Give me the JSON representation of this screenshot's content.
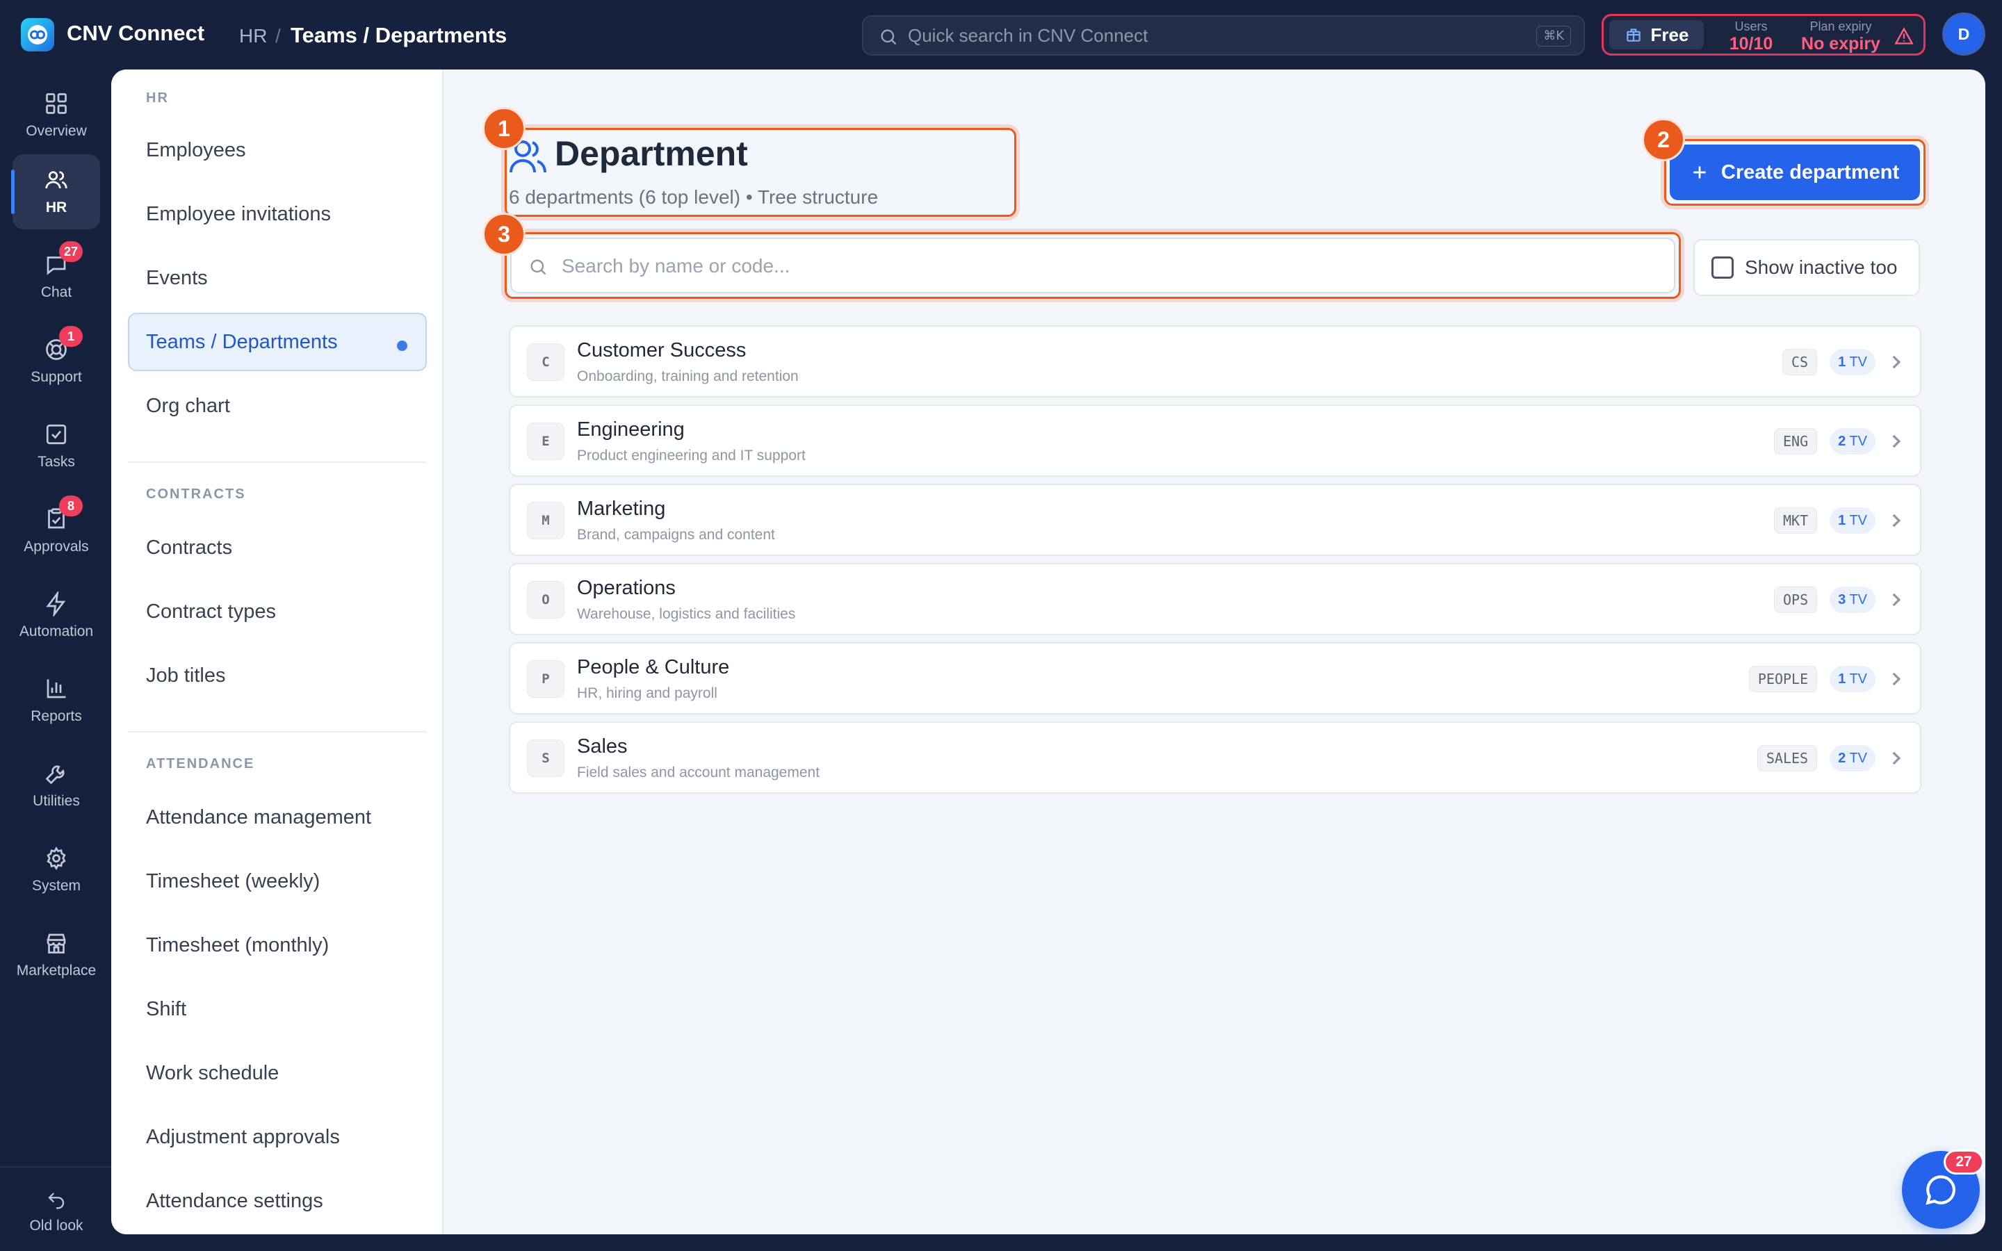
{
  "app": {
    "name": "CNV Connect"
  },
  "breadcrumb": {
    "section": "HR",
    "separator": "/",
    "current": "Teams / Departments"
  },
  "top_search": {
    "placeholder": "Quick search in CNV Connect",
    "shortcut": "⌘K"
  },
  "plan": {
    "name": "Free",
    "users_label": "Users",
    "users_value": "10/10",
    "expiry_label": "Plan expiry",
    "expiry_value": "No expiry"
  },
  "user": {
    "initial": "D"
  },
  "rail": [
    {
      "label": "Overview",
      "icon": "grid-icon"
    },
    {
      "label": "HR",
      "icon": "users-icon",
      "active": true
    },
    {
      "label": "Chat",
      "icon": "chat-icon",
      "badge": "27"
    },
    {
      "label": "Support",
      "icon": "lifebuoy-icon",
      "badge": "1"
    },
    {
      "label": "Tasks",
      "icon": "checkbox-icon"
    },
    {
      "label": "Approvals",
      "icon": "approval-icon",
      "badge": "8"
    },
    {
      "label": "Automation",
      "icon": "lightning-icon"
    },
    {
      "label": "Reports",
      "icon": "bar-chart-icon"
    },
    {
      "label": "Utilities",
      "icon": "wrench-icon"
    },
    {
      "label": "System",
      "icon": "gear-icon"
    },
    {
      "label": "Marketplace",
      "icon": "store-icon"
    }
  ],
  "rail_bottom": {
    "label": "Old look"
  },
  "subnav": {
    "hr_title": "HR",
    "hr_items": [
      "Employees",
      "Employee invitations",
      "Events",
      "Teams / Departments",
      "Org chart"
    ],
    "contracts_title": "CONTRACTS",
    "contracts_items": [
      "Contracts",
      "Contract types",
      "Job titles"
    ],
    "attendance_title": "ATTENDANCE",
    "attendance_items": [
      "Attendance management",
      "Timesheet (weekly)",
      "Timesheet (monthly)",
      "Shift",
      "Work schedule",
      "Adjustment approvals",
      "Attendance settings"
    ]
  },
  "page": {
    "title": "Department",
    "subtitle": "6 departments (6 top level) • Tree structure",
    "create_label": "Create department",
    "search_placeholder": "Search by name or code...",
    "show_inactive_label": "Show inactive too",
    "steps": [
      "1",
      "2",
      "3"
    ]
  },
  "departments": [
    {
      "letter": "C",
      "name": "Customer Success",
      "desc": "Onboarding, training and retention",
      "code": "CS",
      "count": "1",
      "unit": "TV"
    },
    {
      "letter": "E",
      "name": "Engineering",
      "desc": "Product engineering and IT support",
      "code": "ENG",
      "count": "2",
      "unit": "TV"
    },
    {
      "letter": "M",
      "name": "Marketing",
      "desc": "Brand, campaigns and content",
      "code": "MKT",
      "count": "1",
      "unit": "TV"
    },
    {
      "letter": "O",
      "name": "Operations",
      "desc": "Warehouse, logistics and facilities",
      "code": "OPS",
      "count": "3",
      "unit": "TV"
    },
    {
      "letter": "P",
      "name": "People & Culture",
      "desc": "HR, hiring and payroll",
      "code": "PEOPLE",
      "count": "1",
      "unit": "TV"
    },
    {
      "letter": "S",
      "name": "Sales",
      "desc": "Field sales and account management",
      "code": "SALES",
      "count": "2",
      "unit": "TV"
    }
  ],
  "chat_fab": {
    "badge": "27"
  },
  "colors": {
    "accent": "#2563eb",
    "highlight": "#ea5a1c",
    "badge": "#ef3e5c",
    "topbar": "#16213d"
  }
}
